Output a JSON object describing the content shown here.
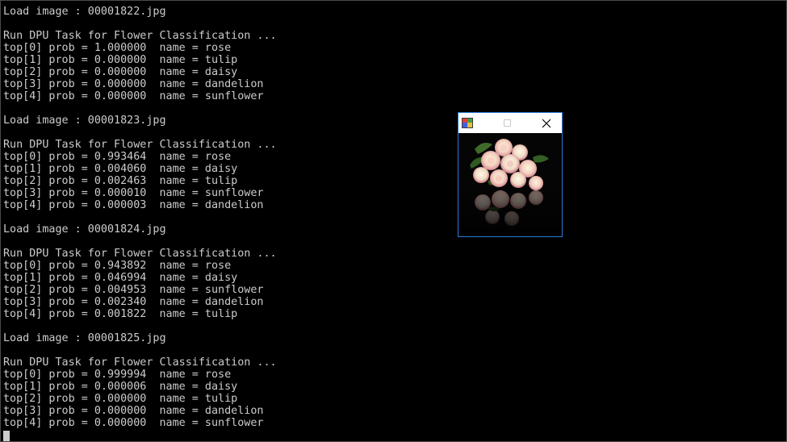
{
  "terminal": {
    "lines": [
      "Load image : 00001822.jpg",
      "",
      "Run DPU Task for Flower Classification ...",
      "top[0] prob = 1.000000  name = rose",
      "top[1] prob = 0.000000  name = tulip",
      "top[2] prob = 0.000000  name = daisy",
      "top[3] prob = 0.000000  name = dandelion",
      "top[4] prob = 0.000000  name = sunflower",
      "",
      "Load image : 00001823.jpg",
      "",
      "Run DPU Task for Flower Classification ...",
      "top[0] prob = 0.993464  name = rose",
      "top[1] prob = 0.004060  name = daisy",
      "top[2] prob = 0.002463  name = tulip",
      "top[3] prob = 0.000010  name = sunflower",
      "top[4] prob = 0.000003  name = dandelion",
      "",
      "Load image : 00001824.jpg",
      "",
      "Run DPU Task for Flower Classification ...",
      "top[0] prob = 0.943892  name = rose",
      "top[1] prob = 0.046994  name = daisy",
      "top[2] prob = 0.004953  name = sunflower",
      "top[3] prob = 0.002340  name = dandelion",
      "top[4] prob = 0.001822  name = tulip",
      "",
      "Load image : 00001825.jpg",
      "",
      "Run DPU Task for Flower Classification ...",
      "top[0] prob = 0.999994  name = rose",
      "top[1] prob = 0.000006  name = daisy",
      "top[2] prob = 0.000000  name = tulip",
      "top[3] prob = 0.000000  name = dandelion",
      "top[4] prob = 0.000000  name = sunflower"
    ]
  },
  "image_window": {
    "icon": "opencv-app-icon",
    "maximize_icon": "maximize-icon",
    "close_icon": "close-icon",
    "image": "rose-bouquet-image"
  },
  "colors": {
    "terminal_bg": "#000000",
    "terminal_text": "#cccccc",
    "window_border": "#2b79d8"
  }
}
